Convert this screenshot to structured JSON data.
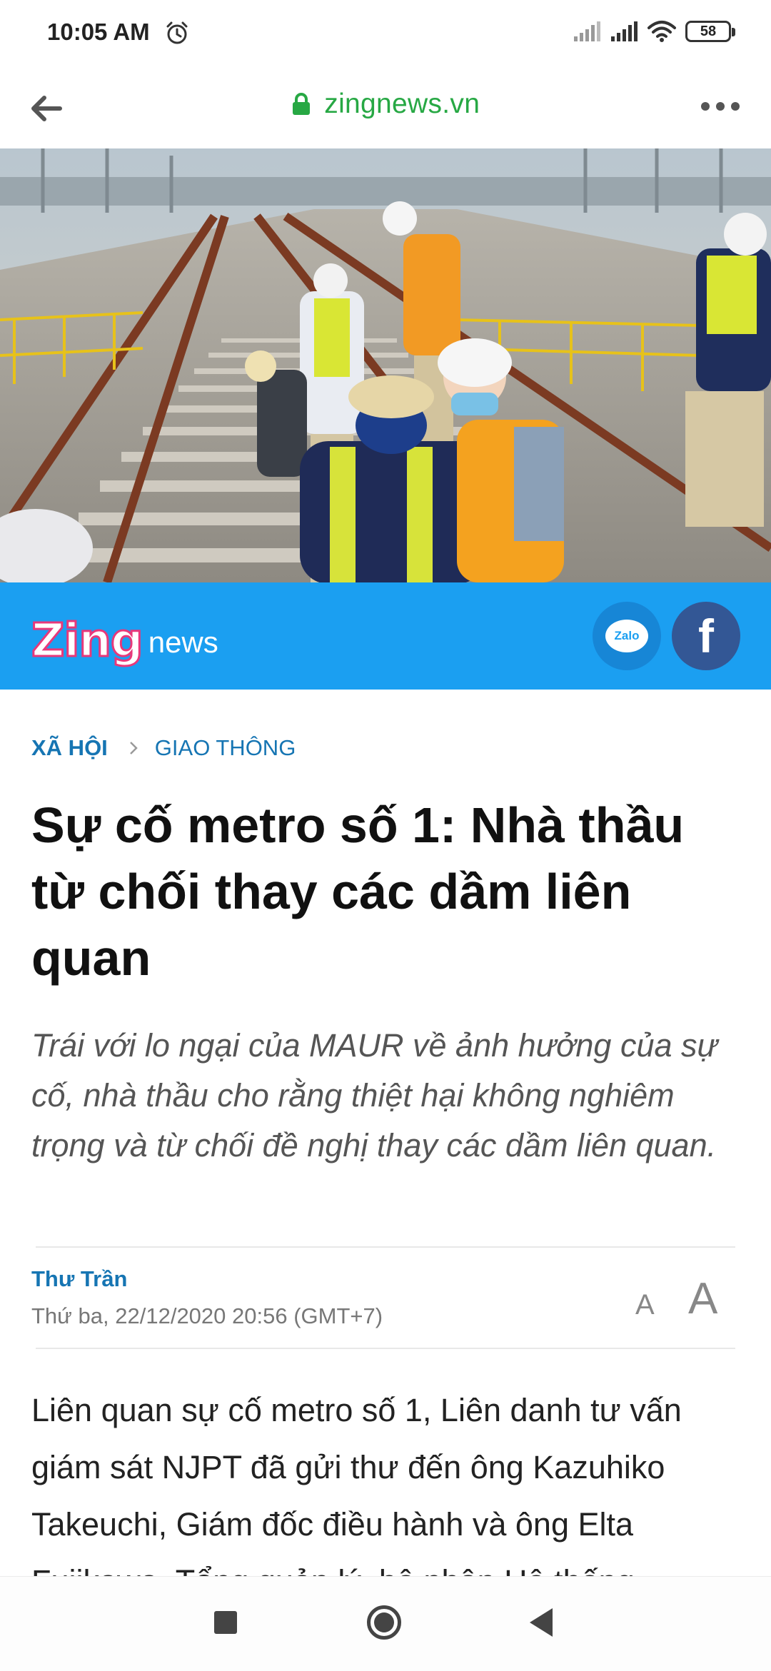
{
  "status_bar": {
    "time": "10:05 AM",
    "battery": "58"
  },
  "browser": {
    "url": "zingnews.vn"
  },
  "banner": {
    "logo_zing": "Zing",
    "logo_news": "news",
    "zalo_label": "Zalo",
    "facebook_label": "f",
    "colors": {
      "banner": "#1b9ff1",
      "facebook": "#335795"
    }
  },
  "article": {
    "breadcrumb": [
      "XÃ HỘI",
      "GIAO THÔNG"
    ],
    "title": "Sự cố metro số 1: Nhà thầu từ chối thay các dầm liên quan",
    "sapo": "Trái với lo ngại của MAUR về ảnh hưởng của sự cố, nhà thầu cho rằng thiệt hại không nghiêm trọng và từ chối đề nghị thay các dầm liên quan.",
    "author": "Thư Trần",
    "date": "Thứ ba, 22/12/2020 20:56 (GMT+7)",
    "font_small": "A",
    "font_large": "A",
    "body": "Liên quan sự cố metro số 1, Liên danh tư vấn giám sát NJPT đã gửi thư đến ông Kazuhiko Takeuchi, Giám đốc điều hành và ông Elta Fujikawa, Tổng quản lý, bộ phận Hệ thống"
  }
}
